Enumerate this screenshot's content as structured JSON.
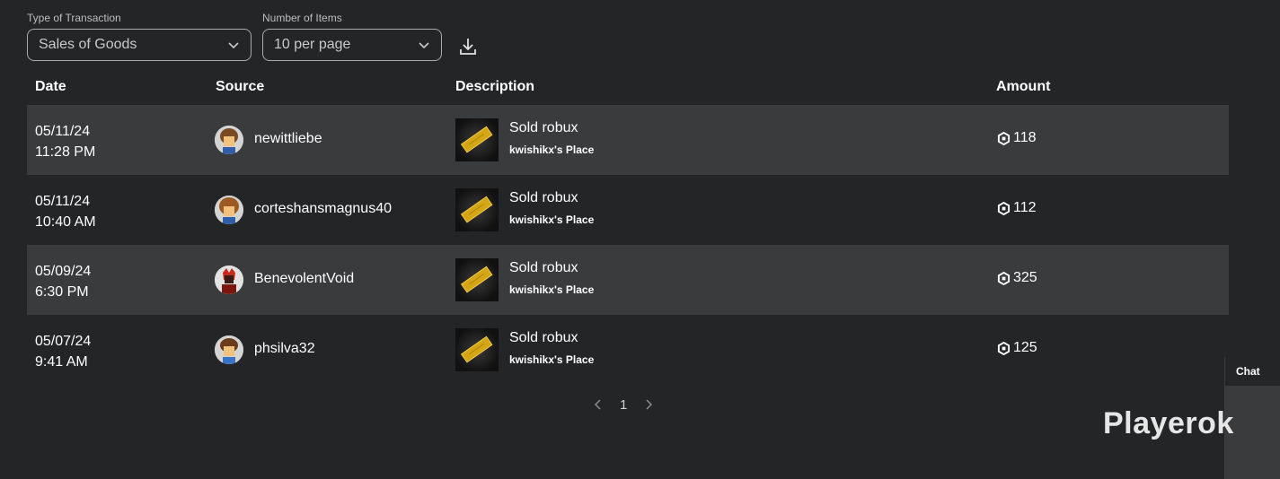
{
  "filters": {
    "transaction_type": {
      "label": "Type of Transaction",
      "value": "Sales of Goods"
    },
    "items_per_page": {
      "label": "Number of Items",
      "value": "10 per page"
    }
  },
  "table": {
    "columns": [
      "Date",
      "Source",
      "Description",
      "Amount"
    ],
    "rows": [
      {
        "date": "05/11/24",
        "time": "11:28 PM",
        "source": "newittliebe",
        "title": "Sold robux",
        "place": "kwishikx's Place",
        "amount": "118"
      },
      {
        "date": "05/11/24",
        "time": "10:40 AM",
        "source": "corteshansmagnus40",
        "title": "Sold robux",
        "place": "kwishikx's Place",
        "amount": "112"
      },
      {
        "date": "05/09/24",
        "time": "6:30 PM",
        "source": "BenevolentVoid",
        "title": "Sold robux",
        "place": "kwishikx's Place",
        "amount": "325"
      },
      {
        "date": "05/07/24",
        "time": "9:41 AM",
        "source": "phsilva32",
        "title": "Sold robux",
        "place": "kwishikx's Place",
        "amount": "125"
      }
    ]
  },
  "pagination": {
    "current_page": "1"
  },
  "chat": {
    "label": "Chat"
  },
  "watermark": "Playerok",
  "icons": {
    "dropdown": "chevron-down-icon",
    "download": "download-icon",
    "currency": "robux-icon",
    "prev": "chevron-left-icon",
    "next": "chevron-right-icon"
  },
  "colors": {
    "background": "#232527",
    "row_alt": "#393b3d",
    "text": "#ffffff"
  }
}
